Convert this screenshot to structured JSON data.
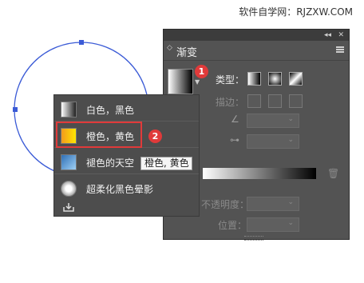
{
  "watermark": "软件自学网：RJZXW.COM",
  "panel": {
    "title": "渐变",
    "type_label": "类型：",
    "stroke_label": "描边：",
    "opacity_label": "不透明度：",
    "position_label": "位置："
  },
  "badges": {
    "one": "1",
    "two": "2"
  },
  "presets": [
    {
      "label": "白色，黑色"
    },
    {
      "label": "橙色，黄色"
    },
    {
      "label": "褪色的天空"
    },
    {
      "label": "超柔化黑色晕影"
    }
  ],
  "tooltip": "橙色, 黄色",
  "colors": {
    "accent_red": "#e03a3a",
    "panel_bg": "#535353"
  },
  "icons": [
    "panel-menu-icon",
    "angle-icon",
    "aspect-ratio-icon",
    "trash-icon",
    "save-preset-icon"
  ]
}
